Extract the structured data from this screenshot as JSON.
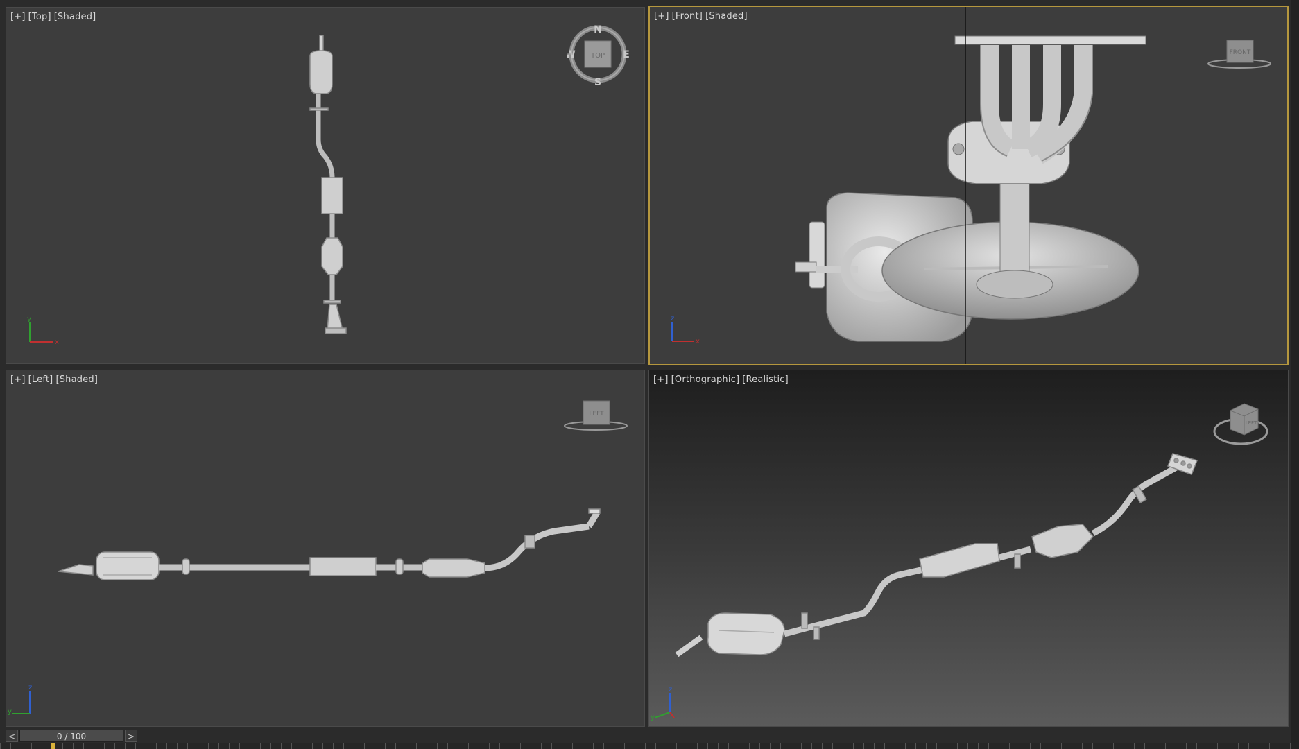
{
  "viewports": {
    "top": {
      "plus": "[+]",
      "view": "[Top]",
      "mode": "[Shaded]"
    },
    "front": {
      "plus": "[+]",
      "view": "[Front]",
      "mode": "[Shaded]"
    },
    "left": {
      "plus": "[+]",
      "view": "[Left]",
      "mode": "[Shaded]"
    },
    "ortho": {
      "plus": "[+]",
      "view": "[Orthographic]",
      "mode": "[Realistic]"
    }
  },
  "viewcube": {
    "top_face": "TOP",
    "front_face": "FRONT",
    "left_face": "LEFT",
    "compass": {
      "n": "N",
      "s": "S",
      "e": "E",
      "w": "W"
    }
  },
  "axes": {
    "x": "x",
    "y": "y",
    "z": "z"
  },
  "timeline": {
    "frame_display": "0 / 100",
    "prev_label": "<",
    "next_label": ">"
  },
  "colors": {
    "active_border": "#b5973e",
    "axis_x": "#c03030",
    "axis_y": "#30a030",
    "axis_z": "#3060d0"
  }
}
